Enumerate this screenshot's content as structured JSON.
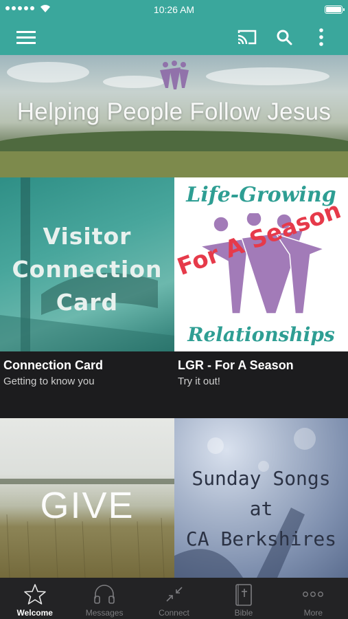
{
  "status_bar": {
    "time": "10:26 AM"
  },
  "app_bar": {
    "icons": [
      "hamburger-menu-icon",
      "cast-icon",
      "search-icon",
      "more-vertical-icon"
    ],
    "accent_color": "#3aa79c"
  },
  "hero": {
    "title": "Helping People Follow Jesus"
  },
  "tiles": [
    {
      "image_text": [
        "Visitor",
        "Connection",
        "Card"
      ],
      "title": "Connection Card",
      "subtitle": "Getting to know you"
    },
    {
      "image_text_top": "Life-Growing",
      "image_text_overlay": "For A Season",
      "image_text_bottom": "Relationships",
      "title": "LGR - For A Season",
      "subtitle": "Try it out!"
    },
    {
      "image_text": "GIVE"
    },
    {
      "image_text": [
        "Sunday Songs",
        "at",
        "CA Berkshires"
      ]
    }
  ],
  "tab_bar": {
    "tabs": [
      {
        "label": "Welcome",
        "icon": "star-icon",
        "active": true
      },
      {
        "label": "Messages",
        "icon": "headphones-icon",
        "active": false
      },
      {
        "label": "Connect",
        "icon": "connect-arrows-icon",
        "active": false
      },
      {
        "label": "Bible",
        "icon": "bible-icon",
        "active": false
      },
      {
        "label": "More",
        "icon": "ellipsis-icon",
        "active": false
      }
    ]
  }
}
